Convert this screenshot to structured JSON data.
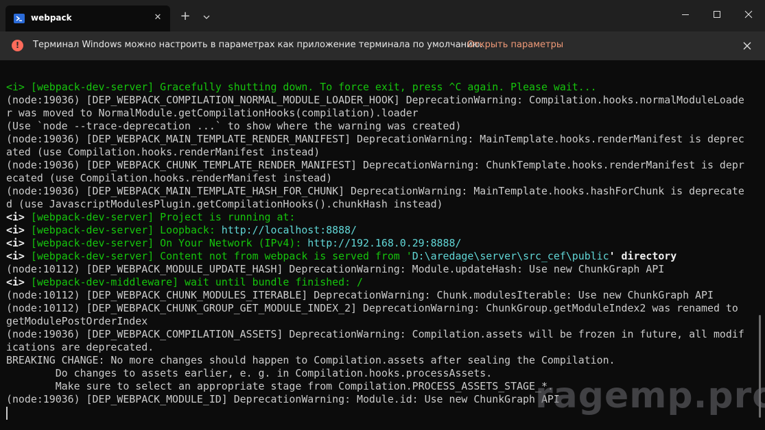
{
  "tab": {
    "title": "webpack",
    "icon": "powershell-icon"
  },
  "titlebar": {
    "new_tab": "+",
    "close_tab": "✕"
  },
  "colors": {
    "accent": "#16c60c",
    "cyan": "#61d6d6",
    "info": "#ff6b5b",
    "link": "#f09a78"
  },
  "infobar": {
    "icon": "!",
    "message": "Терминал Windows можно настроить в параметрах как приложение терминала по умолчанию.",
    "action": "Открыть параметры"
  },
  "terminal": {
    "lines": [
      [
        [
          "g",
          "<i> "
        ],
        [
          "g",
          "[webpack-dev-server] Gracefully shutting down. To force exit, press ^C again. Please wait..."
        ]
      ],
      [
        [
          "n",
          "(node:19036) [DEP_WEBPACK_COMPILATION_NORMAL_MODULE_LOADER_HOOK] DeprecationWarning: Compilation.hooks.normalModuleLoade"
        ]
      ],
      [
        [
          "n",
          "r was moved to NormalModule.getCompilationHooks(compilation).loader"
        ]
      ],
      [
        [
          "n",
          "(Use `node --trace-deprecation ...` to show where the warning was created)"
        ]
      ],
      [
        [
          "n",
          "(node:19036) [DEP_WEBPACK_MAIN_TEMPLATE_RENDER_MANIFEST] DeprecationWarning: MainTemplate.hooks.renderManifest is deprec"
        ]
      ],
      [
        [
          "n",
          "ated (use Compilation.hooks.renderManifest instead)"
        ]
      ],
      [
        [
          "n",
          "(node:19036) [DEP_WEBPACK_CHUNK_TEMPLATE_RENDER_MANIFEST] DeprecationWarning: ChunkTemplate.hooks.renderManifest is depr"
        ]
      ],
      [
        [
          "n",
          "ecated (use Compilation.hooks.renderManifest instead)"
        ]
      ],
      [
        [
          "n",
          "(node:19036) [DEP_WEBPACK_MAIN_TEMPLATE_HASH_FOR_CHUNK] DeprecationWarning: MainTemplate.hooks.hashForChunk is deprecate"
        ]
      ],
      [
        [
          "n",
          "d (use JavascriptModulesPlugin.getCompilationHooks().chunkHash instead)"
        ]
      ],
      [
        [
          "w",
          "<i> "
        ],
        [
          "g",
          "[webpack-dev-server] Project is running at:"
        ]
      ],
      [
        [
          "w",
          "<i> "
        ],
        [
          "g",
          "[webpack-dev-server] Loopback: "
        ],
        [
          "c",
          "http://localhost:8888/"
        ]
      ],
      [
        [
          "w",
          "<i> "
        ],
        [
          "g",
          "[webpack-dev-server] On Your Network (IPv4): "
        ],
        [
          "c",
          "http://192.168.0.29:8888/"
        ]
      ],
      [
        [
          "w",
          "<i> "
        ],
        [
          "g",
          "[webpack-dev-server] Content not from webpack is served from '"
        ],
        [
          "c",
          "D:\\aredage\\server\\src_cef\\public"
        ],
        [
          "w",
          "' directory"
        ]
      ],
      [
        [
          "n",
          "(node:10112) [DEP_WEBPACK_MODULE_UPDATE_HASH] DeprecationWarning: Module.updateHash: Use new ChunkGraph API"
        ]
      ],
      [
        [
          "w",
          "<i> "
        ],
        [
          "g",
          "[webpack-dev-middleware] wait until bundle finished: /"
        ]
      ],
      [
        [
          "n",
          "(node:10112) [DEP_WEBPACK_CHUNK_MODULES_ITERABLE] DeprecationWarning: Chunk.modulesIterable: Use new ChunkGraph API"
        ]
      ],
      [
        [
          "n",
          "(node:10112) [DEP_WEBPACK_CHUNK_GROUP_GET_MODULE_INDEX_2] DeprecationWarning: ChunkGroup.getModuleIndex2 was renamed to"
        ]
      ],
      [
        [
          "n",
          "getModulePostOrderIndex"
        ]
      ],
      [
        [
          "n",
          "(node:19036) [DEP_WEBPACK_COMPILATION_ASSETS] DeprecationWarning: Compilation.assets will be frozen in future, all modif"
        ]
      ],
      [
        [
          "n",
          "ications are deprecated."
        ]
      ],
      [
        [
          "n",
          "BREAKING CHANGE: No more changes should happen to Compilation.assets after sealing the Compilation."
        ]
      ],
      [
        [
          "n",
          "        Do changes to assets earlier, e. g. in Compilation.hooks.processAssets."
        ]
      ],
      [
        [
          "n",
          "        Make sure to select an appropriate stage from Compilation.PROCESS_ASSETS_STAGE_*."
        ]
      ],
      [
        [
          "n",
          "(node:19036) [DEP_WEBPACK_MODULE_ID] DeprecationWarning: Module.id: Use new ChunkGraph API"
        ]
      ]
    ]
  },
  "watermark": "ragemp.pro"
}
